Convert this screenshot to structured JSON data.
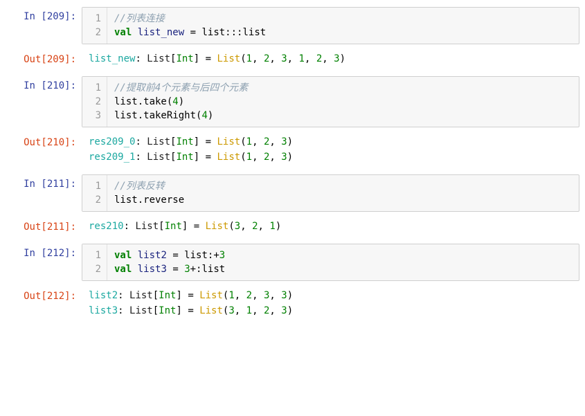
{
  "cells": [
    {
      "in_prompt_prefix": "In  ",
      "in_prompt_num": "[209]",
      "in_prompt_colon": ":",
      "line_nums": [
        "1",
        "2"
      ],
      "code_line1_comment": "//列表连接",
      "code_line2_kw": "val",
      "code_line2_space1": " ",
      "code_line2_var": "list_new",
      "code_line2_mid": " = list:::list",
      "out_prompt_prefix": "Out",
      "out_prompt_num": "[209]",
      "out_prompt_colon": ":",
      "out_var": "list_new",
      "out_colon": ": ",
      "out_type_list": "List",
      "out_lbr": "[",
      "out_int": "Int",
      "out_rbr": "]",
      "out_eq": " = ",
      "out_listfn": "List",
      "out_lpar": "(",
      "out_vals": [
        {
          "n": "1",
          "c": ", "
        },
        {
          "n": "2",
          "c": ", "
        },
        {
          "n": "3",
          "c": ", "
        },
        {
          "n": "1",
          "c": ", "
        },
        {
          "n": "2",
          "c": ", "
        },
        {
          "n": "3",
          "c": ""
        }
      ],
      "out_rpar": ")"
    },
    {
      "in_prompt_prefix": "In  ",
      "in_prompt_num": "[210]",
      "in_prompt_colon": ":",
      "line_nums": [
        "1",
        "2",
        "3"
      ],
      "code_line1_comment": "//提取前4个元素与后四个元素",
      "code_line2_pre": "list.take(",
      "code_line2_num": "4",
      "code_line2_post": ")",
      "code_line3_pre": "list.takeRight(",
      "code_line3_num": "4",
      "code_line3_post": ")",
      "out_prompt_prefix": "Out",
      "out_prompt_num": "[210]",
      "out_prompt_colon": ":",
      "out_rows": [
        {
          "var": "res209_0",
          "colon": ": ",
          "type_list": "List",
          "lbr": "[",
          "int": "Int",
          "rbr": "]",
          "eq": " = ",
          "listfn": "List",
          "lpar": "(",
          "vals": [
            {
              "n": "1",
              "c": ", "
            },
            {
              "n": "2",
              "c": ", "
            },
            {
              "n": "3",
              "c": ""
            }
          ],
          "rpar": ")"
        },
        {
          "var": "res209_1",
          "colon": ": ",
          "type_list": "List",
          "lbr": "[",
          "int": "Int",
          "rbr": "]",
          "eq": " = ",
          "listfn": "List",
          "lpar": "(",
          "vals": [
            {
              "n": "1",
              "c": ", "
            },
            {
              "n": "2",
              "c": ", "
            },
            {
              "n": "3",
              "c": ""
            }
          ],
          "rpar": ")"
        }
      ]
    },
    {
      "in_prompt_prefix": "In  ",
      "in_prompt_num": "[211]",
      "in_prompt_colon": ":",
      "line_nums": [
        "1",
        "2"
      ],
      "code_line1_comment": "//列表反转",
      "code_line2_text": "list.reverse",
      "out_prompt_prefix": "Out",
      "out_prompt_num": "[211]",
      "out_prompt_colon": ":",
      "out_var": "res210",
      "out_colon": ": ",
      "out_type_list": "List",
      "out_lbr": "[",
      "out_int": "Int",
      "out_rbr": "]",
      "out_eq": " = ",
      "out_listfn": "List",
      "out_lpar": "(",
      "out_vals": [
        {
          "n": "3",
          "c": ", "
        },
        {
          "n": "2",
          "c": ", "
        },
        {
          "n": "1",
          "c": ""
        }
      ],
      "out_rpar": ")"
    },
    {
      "in_prompt_prefix": "In  ",
      "in_prompt_num": "[212]",
      "in_prompt_colon": ":",
      "line_nums": [
        "1",
        "2"
      ],
      "code_line1_kw": "val",
      "code_line1_sp": " ",
      "code_line1_var": "list2",
      "code_line1_mid": " = list:+",
      "code_line1_num": "3",
      "code_line2_kw": "val",
      "code_line2_sp": " ",
      "code_line2_var": "list3",
      "code_line2_eq": " = ",
      "code_line2_num": "3",
      "code_line2_post": "+:list",
      "out_prompt_prefix": "Out",
      "out_prompt_num": "[212]",
      "out_prompt_colon": ":",
      "out_rows": [
        {
          "var": "list2",
          "colon": ": ",
          "type_list": "List",
          "lbr": "[",
          "int": "Int",
          "rbr": "]",
          "eq": " = ",
          "listfn": "List",
          "lpar": "(",
          "vals": [
            {
              "n": "1",
              "c": ", "
            },
            {
              "n": "2",
              "c": ", "
            },
            {
              "n": "3",
              "c": ", "
            },
            {
              "n": "3",
              "c": ""
            }
          ],
          "rpar": ")"
        },
        {
          "var": "list3",
          "colon": ": ",
          "type_list": "List",
          "lbr": "[",
          "int": "Int",
          "rbr": "]",
          "eq": " = ",
          "listfn": "List",
          "lpar": "(",
          "vals": [
            {
              "n": "3",
              "c": ", "
            },
            {
              "n": "1",
              "c": ", "
            },
            {
              "n": "2",
              "c": ", "
            },
            {
              "n": "3",
              "c": ""
            }
          ],
          "rpar": ")"
        }
      ]
    }
  ]
}
